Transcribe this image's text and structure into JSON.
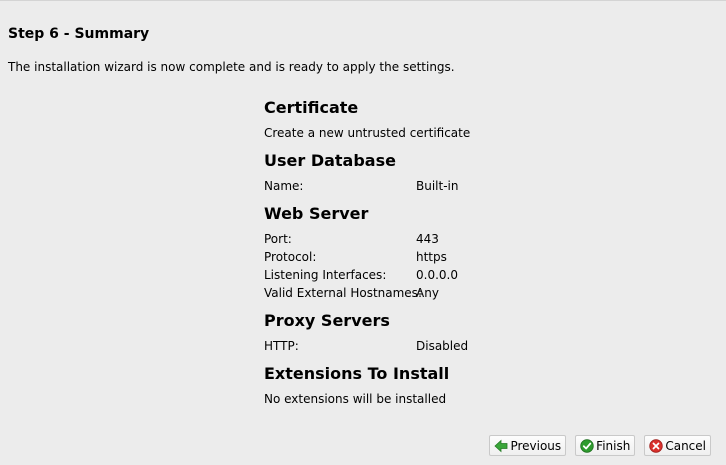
{
  "page": {
    "title": "Step 6 - Summary",
    "intro": "The installation wizard is now complete and is ready to apply the settings."
  },
  "certificate": {
    "heading": "Certificate",
    "text": "Create a new untrusted certificate"
  },
  "user_database": {
    "heading": "User Database",
    "rows": [
      {
        "label": "Name:",
        "value": "Built-in"
      }
    ]
  },
  "web_server": {
    "heading": "Web Server",
    "rows": [
      {
        "label": "Port:",
        "value": "443"
      },
      {
        "label": "Protocol:",
        "value": "https"
      },
      {
        "label": "Listening Interfaces:",
        "value": "0.0.0.0"
      },
      {
        "label": "Valid External Hostnames:",
        "value": "Any"
      }
    ]
  },
  "proxy_servers": {
    "heading": "Proxy Servers",
    "rows": [
      {
        "label": "HTTP:",
        "value": "Disabled"
      }
    ]
  },
  "extensions": {
    "heading": "Extensions To Install",
    "text": "No extensions will be installed"
  },
  "buttons": {
    "previous": "Previous",
    "finish": "Finish",
    "cancel": "Cancel"
  },
  "colors": {
    "previous_icon": "#3aa63a",
    "finish_icon": "#2e9b2e",
    "cancel_icon": "#d9302c"
  },
  "icons": {
    "previous": "arrow-left-icon",
    "finish": "check-circle-icon",
    "cancel": "cancel-circle-icon"
  }
}
